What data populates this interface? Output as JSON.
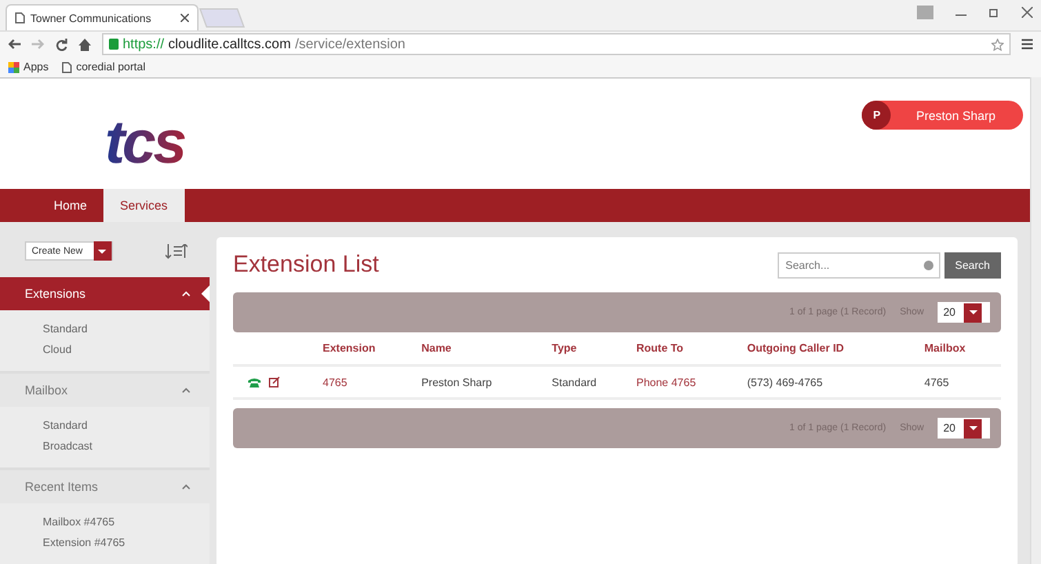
{
  "browser": {
    "tab_title": "Towner Communications",
    "url_scheme": "https://",
    "url_host": "cloudlite.calltcs.com",
    "url_path": "/service/extension",
    "bookmarks": [
      "Apps",
      "coredial portal"
    ]
  },
  "header": {
    "logo": "tcs",
    "user": {
      "initial": "P",
      "name": "Preston Sharp"
    }
  },
  "nav": [
    {
      "label": "Home",
      "selected": false
    },
    {
      "label": "Services",
      "selected": true
    }
  ],
  "sidebar": {
    "create_button": "Create New",
    "sections": [
      {
        "title": "Extensions",
        "selected": true,
        "expanded": true,
        "items": [
          "Standard",
          "Cloud"
        ]
      },
      {
        "title": "Mailbox",
        "selected": false,
        "expanded": true,
        "items": [
          "Standard",
          "Broadcast"
        ]
      },
      {
        "title": "Recent Items",
        "selected": false,
        "expanded": true,
        "items": [
          "Mailbox #4765",
          "Extension #4765"
        ]
      }
    ]
  },
  "main": {
    "title": "Extension List",
    "search": {
      "placeholder": "Search...",
      "button": "Search"
    },
    "pager_top": {
      "summary": "1 of 1 page (1 Record)",
      "show_label": "Show",
      "page_size": "20"
    },
    "table": {
      "columns": [
        "Extension",
        "Name",
        "Type",
        "Route To",
        "Outgoing Caller ID",
        "Mailbox"
      ],
      "rows": [
        {
          "extension": "4765",
          "name": "Preston Sharp",
          "type": "Standard",
          "route_to": "Phone 4765",
          "caller_id": "(573) 469-4765",
          "mailbox": "4765"
        }
      ]
    },
    "pager_bottom": {
      "summary": "1 of 1 page (1 Record)",
      "show_label": "Show",
      "page_size": "20"
    }
  }
}
